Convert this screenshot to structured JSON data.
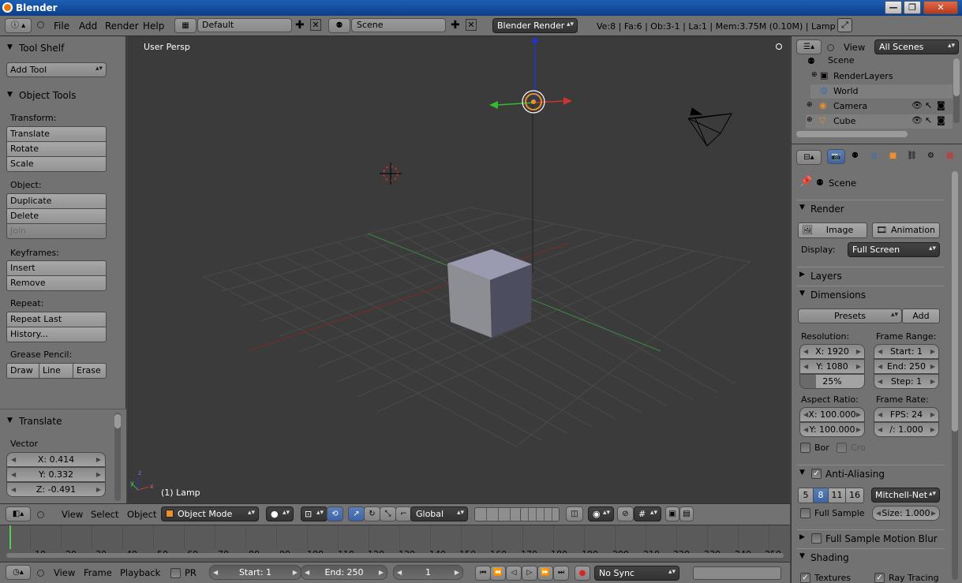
{
  "app": {
    "title": "Blender"
  },
  "window_buttons": {
    "minimize": "—",
    "maximize": "❐",
    "close": "✕"
  },
  "menu": {
    "items": [
      "File",
      "Add",
      "Render",
      "Help"
    ],
    "layout": "Default",
    "scene": "Scene",
    "engine": "Blender Render",
    "stats": "Ve:8 | Fa:6 | Ob:3-1 | La:1 | Mem:3.75M (0.10M) | Lamp"
  },
  "toolshelf": {
    "title": "Tool Shelf",
    "add_tool": "Add Tool",
    "object_tools": "Object Tools",
    "transform_label": "Transform:",
    "transform": [
      "Translate",
      "Rotate",
      "Scale"
    ],
    "object_label": "Object:",
    "object": [
      "Duplicate",
      "Delete",
      "Join"
    ],
    "keyframes_label": "Keyframes:",
    "keyframes": [
      "Insert",
      "Remove"
    ],
    "repeat_label": "Repeat:",
    "repeat": [
      "Repeat Last",
      "History..."
    ],
    "grease_label": "Grease Pencil:",
    "grease": [
      "Draw",
      "Line",
      "Erase"
    ],
    "operator": "Translate",
    "vector_label": "Vector",
    "vector": [
      "X: 0.414",
      "Y: 0.332",
      "Z: -0.491"
    ]
  },
  "viewport": {
    "view_name": "User Persp",
    "object_label": "(1) Lamp",
    "axis_x": "x",
    "axis_y": "y",
    "axis_z": "z"
  },
  "view3d_header": {
    "menus": [
      "View",
      "Select",
      "Object"
    ],
    "mode": "Object Mode",
    "orientation": "Global"
  },
  "timeline": {
    "ticks": [
      "10",
      "20",
      "30",
      "40",
      "50",
      "60",
      "70",
      "80",
      "90",
      "100",
      "110",
      "120",
      "130",
      "140",
      "150",
      "160",
      "170",
      "180",
      "190",
      "200",
      "210",
      "220",
      "230",
      "240",
      "250"
    ]
  },
  "timeline_header": {
    "menus": [
      "View",
      "Frame",
      "Playback"
    ],
    "pr": "PR",
    "start": "Start: 1",
    "end": "End: 250",
    "current": "1",
    "sync": "No Sync"
  },
  "outliner": {
    "view": "View",
    "scenes": "All Scenes",
    "items": [
      "Scene",
      "RenderLayers",
      "World",
      "Camera",
      "Cube"
    ]
  },
  "properties": {
    "context": "Scene",
    "render_title": "Render",
    "image_btn": "Image",
    "animation_btn": "Animation",
    "display_label": "Display:",
    "display_value": "Full Screen",
    "layers": "Layers",
    "dimensions": "Dimensions",
    "presets": "Presets",
    "add": "Add",
    "resolution_label": "Resolution:",
    "res_x": "X: 1920",
    "res_y": "Y: 1080",
    "res_pct": "25%",
    "frame_range_label": "Frame Range:",
    "start": "Start: 1",
    "end": "End: 250",
    "step": "Step: 1",
    "aspect_label": "Aspect Ratio:",
    "aspect_x": "X: 100.000",
    "aspect_y": "Y: 100.000",
    "frame_rate_label": "Frame Rate:",
    "fps": "FPS: 24",
    "fps_base": "/: 1.000",
    "border": "Bor",
    "crop": "Cro",
    "anti_aliasing": "Anti-Aliasing",
    "aa_samples": [
      "5",
      "8",
      "11",
      "16"
    ],
    "aa_filter": "Mitchell-Net",
    "full_sample": "Full Sample",
    "size": "Size: 1.000",
    "motion_blur": "Full Sample Motion Blur",
    "shading": "Shading",
    "textures": "Textures",
    "ray_tracing": "Ray Tracing"
  }
}
